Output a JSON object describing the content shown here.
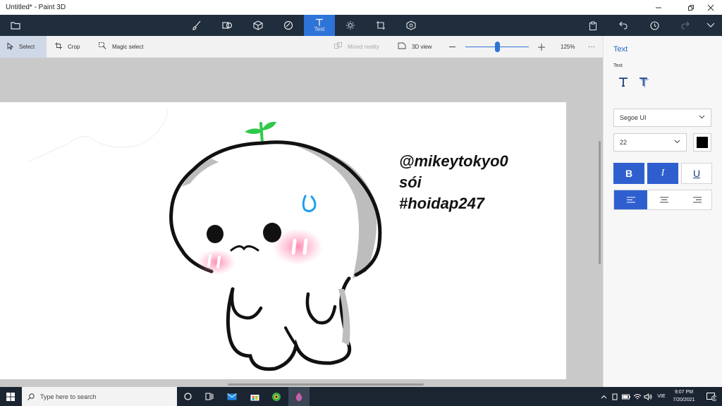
{
  "window": {
    "title": "Untitled* - Paint 3D"
  },
  "main_toolbar": {
    "active_label": "Text"
  },
  "sub_toolbar": {
    "select": "Select",
    "crop": "Crop",
    "magic_select": "Magic select",
    "mixed_reality": "Mixed reality",
    "view_3d": "3D view",
    "zoom": "125%",
    "zoom_level": 0.5,
    "more": "···"
  },
  "canvas": {
    "line1": "@mikeytokyo0",
    "line2": "sói",
    "line3": "#hoidap247"
  },
  "side_panel": {
    "title": "Text",
    "section": "Text",
    "font": "Segoe UI",
    "size": "22",
    "bold": "B",
    "italic": "I",
    "underline": "U",
    "text_color": "#000000"
  },
  "taskbar": {
    "search_placeholder": "Type here to search",
    "time": "9:07 PM",
    "date": "7/20/2021",
    "lang": "VIE",
    "notif_count": "8"
  },
  "colors": {
    "accent": "#2e73d8",
    "toolbar_bg": "#1f2d3d"
  }
}
